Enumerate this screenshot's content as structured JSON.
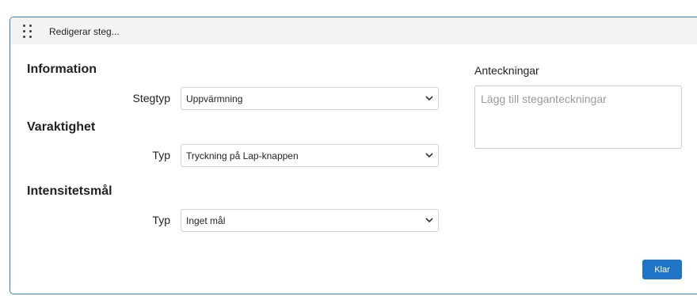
{
  "header": {
    "title": "Redigerar steg..."
  },
  "information": {
    "heading": "Information",
    "step_type_label": "Stegtyp",
    "step_type_value": "Uppvärmning"
  },
  "duration": {
    "heading": "Varaktighet",
    "type_label": "Typ",
    "type_value": "Tryckning på Lap-knappen"
  },
  "intensity": {
    "heading": "Intensitetsmål",
    "type_label": "Typ",
    "type_value": "Inget mål"
  },
  "notes": {
    "label": "Anteckningar",
    "placeholder": "Lägg till steganteckningar",
    "value": ""
  },
  "actions": {
    "done_label": "Klar"
  },
  "colors": {
    "accent": "#1f74c8",
    "panel_border": "#2f80c9",
    "header_bg": "#f3f3f3"
  },
  "icons": {
    "drag": "drag-handle-icon",
    "dropdown": "chevron-down-icon"
  }
}
